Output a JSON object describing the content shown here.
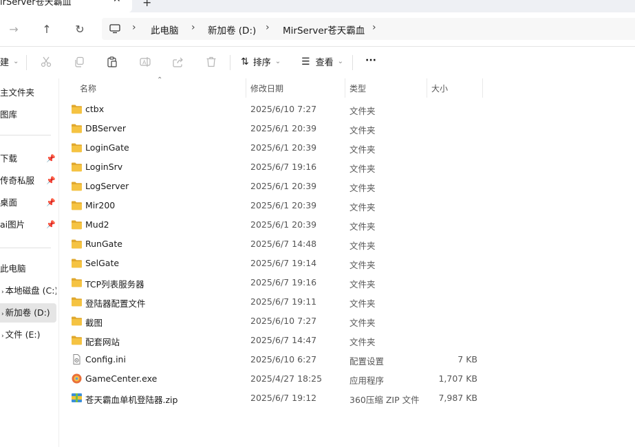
{
  "window": {
    "tab_title": "irServer苍天霸血",
    "close_glyph": "✕",
    "new_tab_glyph": "+"
  },
  "nav": {
    "back_glyph": "←",
    "forward_glyph": "→",
    "up_glyph": "↑",
    "refresh_glyph": "↻",
    "breadcrumb": [
      "此电脑",
      "新加卷 (D:)",
      "MirServer苍天霸血"
    ],
    "sep_glyph": "›"
  },
  "toolbar": {
    "new_label": "建",
    "sort_label": "排序",
    "view_label": "查看",
    "more_glyph": "···",
    "dropdown_glyph": "⌄"
  },
  "sidebar": {
    "items": [
      {
        "label": "主文件夹",
        "pinned": false
      },
      {
        "label": "图库",
        "pinned": false
      },
      {
        "label": "下载",
        "pinned": true
      },
      {
        "label": "传奇私服",
        "pinned": true
      },
      {
        "label": "桌面",
        "pinned": true
      },
      {
        "label": "ai图片",
        "pinned": true
      },
      {
        "label": "此电脑",
        "pinned": false
      },
      {
        "label": "本地磁盘 (C:)",
        "pinned": false
      },
      {
        "label": "新加卷 (D:)",
        "pinned": false,
        "selected": true
      },
      {
        "label": "文件 (E:)",
        "pinned": false
      }
    ],
    "pin_glyph": "📌"
  },
  "columns": {
    "name": "名称",
    "date": "修改日期",
    "type": "类型",
    "size": "大小",
    "sort_glyph": "⌃"
  },
  "files": [
    {
      "name": "ctbx",
      "date": "2025/6/10 7:27",
      "type": "文件夹",
      "size": "",
      "icon": "folder-icon"
    },
    {
      "name": "DBServer",
      "date": "2025/6/1 20:39",
      "type": "文件夹",
      "size": "",
      "icon": "folder-icon"
    },
    {
      "name": "LoginGate",
      "date": "2025/6/1 20:39",
      "type": "文件夹",
      "size": "",
      "icon": "folder-icon"
    },
    {
      "name": "LoginSrv",
      "date": "2025/6/7 19:16",
      "type": "文件夹",
      "size": "",
      "icon": "folder-icon"
    },
    {
      "name": "LogServer",
      "date": "2025/6/1 20:39",
      "type": "文件夹",
      "size": "",
      "icon": "folder-icon"
    },
    {
      "name": "Mir200",
      "date": "2025/6/1 20:39",
      "type": "文件夹",
      "size": "",
      "icon": "folder-icon"
    },
    {
      "name": "Mud2",
      "date": "2025/6/1 20:39",
      "type": "文件夹",
      "size": "",
      "icon": "folder-icon"
    },
    {
      "name": "RunGate",
      "date": "2025/6/7 14:48",
      "type": "文件夹",
      "size": "",
      "icon": "folder-icon"
    },
    {
      "name": "SelGate",
      "date": "2025/6/7 19:14",
      "type": "文件夹",
      "size": "",
      "icon": "folder-icon"
    },
    {
      "name": "TCP列表服务器",
      "date": "2025/6/7 19:16",
      "type": "文件夹",
      "size": "",
      "icon": "folder-icon"
    },
    {
      "name": "登陆器配置文件",
      "date": "2025/6/7 19:11",
      "type": "文件夹",
      "size": "",
      "icon": "folder-icon"
    },
    {
      "name": "截图",
      "date": "2025/6/10 7:27",
      "type": "文件夹",
      "size": "",
      "icon": "folder-icon"
    },
    {
      "name": "配套网站",
      "date": "2025/6/7 14:47",
      "type": "文件夹",
      "size": "",
      "icon": "folder-icon"
    },
    {
      "name": "Config.ini",
      "date": "2025/6/10 6:27",
      "type": "配置设置",
      "size": "7 KB",
      "icon": "ini-file-icon"
    },
    {
      "name": "GameCenter.exe",
      "date": "2025/4/27 18:25",
      "type": "应用程序",
      "size": "1,707 KB",
      "icon": "exe-file-icon"
    },
    {
      "name": "苍天霸血单机登陆器.zip",
      "date": "2025/6/7 19:12",
      "type": "360压缩 ZIP 文件",
      "size": "7,987 KB",
      "icon": "zip-file-icon"
    }
  ],
  "colors": {
    "folder": "#f5c342",
    "folder_dark": "#e0a82e",
    "selected_bg": "#e5e5e5"
  }
}
